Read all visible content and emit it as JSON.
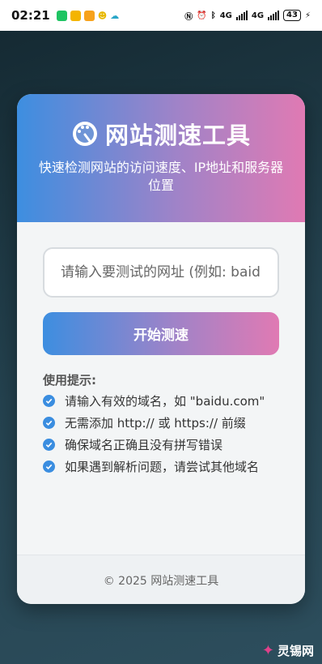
{
  "status_bar": {
    "time": "02:21",
    "network_label": "4G",
    "network_label_2": "4G",
    "battery": "43"
  },
  "header": {
    "title": "网站测速工具",
    "subtitle": "快速检测网站的访问速度、IP地址和服务器位置",
    "icon": "speedometer-icon"
  },
  "form": {
    "url_placeholder": "请输入要测试的网址 (例如: baidu.com)",
    "url_value": "",
    "submit_label": "开始测速"
  },
  "tips": {
    "title": "使用提示:",
    "items": [
      "请输入有效的域名，如 \"baidu.com\"",
      "无需添加 http:// 或 https:// 前缀",
      "确保域名正确且没有拼写错误",
      "如果遇到解析问题，请尝试其他域名"
    ]
  },
  "footer": {
    "copyright": "© 2025 网站测速工具"
  },
  "watermark": {
    "text": "灵锡网"
  },
  "colors": {
    "gradient_start": "#3d8ee0",
    "gradient_mid": "#9f83c8",
    "gradient_end": "#e07ab3",
    "check": "#3a8de0"
  }
}
